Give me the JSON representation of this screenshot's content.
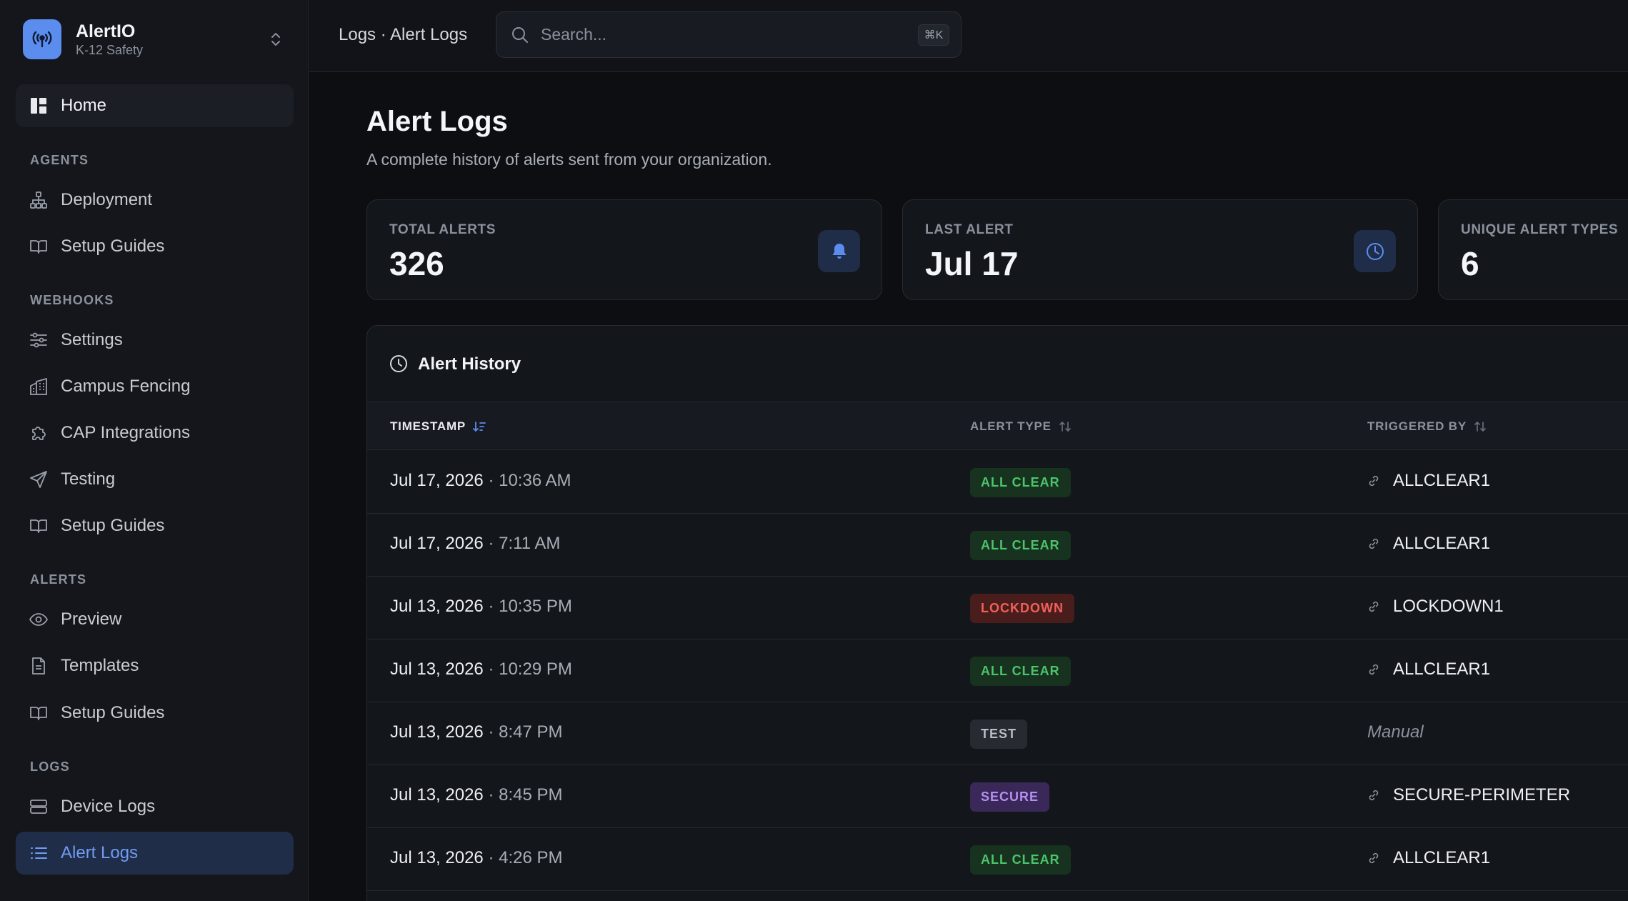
{
  "brand": {
    "name": "AlertIO",
    "subtitle": "K-12 Safety"
  },
  "nav": {
    "home": "Home",
    "sections": {
      "agents": "AGENTS",
      "webhooks": "WEBHOOKS",
      "alerts": "ALERTS",
      "logs": "LOGS"
    },
    "agents": [
      "Deployment",
      "Setup Guides"
    ],
    "webhooks": [
      "Settings",
      "Campus Fencing",
      "CAP Integrations",
      "Testing",
      "Setup Guides"
    ],
    "alerts": [
      "Preview",
      "Templates",
      "Setup Guides"
    ],
    "logs": [
      "Device Logs",
      "Alert Logs"
    ]
  },
  "topbar": {
    "breadcrumb": "Logs · Alert Logs",
    "search_placeholder": "Search...",
    "search_shortcut": "⌘K"
  },
  "page": {
    "title": "Alert Logs",
    "subtitle": "A complete history of alerts sent from your organization."
  },
  "stats": [
    {
      "label": "TOTAL ALERTS",
      "value": "326",
      "icon": "bell-icon"
    },
    {
      "label": "LAST ALERT",
      "value": "Jul 17",
      "icon": "clock-icon"
    },
    {
      "label": "UNIQUE ALERT TYPES",
      "value": "6"
    }
  ],
  "history": {
    "title": "Alert History",
    "columns": [
      "TIMESTAMP",
      "ALERT TYPE",
      "TRIGGERED BY"
    ],
    "rows": [
      {
        "date": "Jul 17, 2026",
        "sep": " · ",
        "time": "10:36 AM",
        "type": "ALL CLEAR",
        "trigger": "ALLCLEAR1"
      },
      {
        "date": "Jul 17, 2026",
        "sep": " · ",
        "time": "7:11 AM",
        "type": "ALL CLEAR",
        "trigger": "ALLCLEAR1"
      },
      {
        "date": "Jul 13, 2026",
        "sep": " · ",
        "time": "10:35 PM",
        "type": "LOCKDOWN",
        "trigger": "LOCKDOWN1"
      },
      {
        "date": "Jul 13, 2026",
        "sep": " · ",
        "time": "10:29 PM",
        "type": "ALL CLEAR",
        "trigger": "ALLCLEAR1"
      },
      {
        "date": "Jul 13, 2026",
        "sep": " · ",
        "time": "8:47 PM",
        "type": "TEST",
        "trigger": "Manual"
      },
      {
        "date": "Jul 13, 2026",
        "sep": " · ",
        "time": "8:45 PM",
        "type": "SECURE",
        "trigger": "SECURE-PERIMETER"
      },
      {
        "date": "Jul 13, 2026",
        "sep": " · ",
        "time": "4:26 PM",
        "type": "ALL CLEAR",
        "trigger": "ALLCLEAR1"
      }
    ]
  },
  "colors": {
    "accent": "#5b8def",
    "all_clear": "#4cc46b",
    "lockdown": "#f0605a",
    "secure": "#b68ef0",
    "test": "#b8bcc4"
  }
}
